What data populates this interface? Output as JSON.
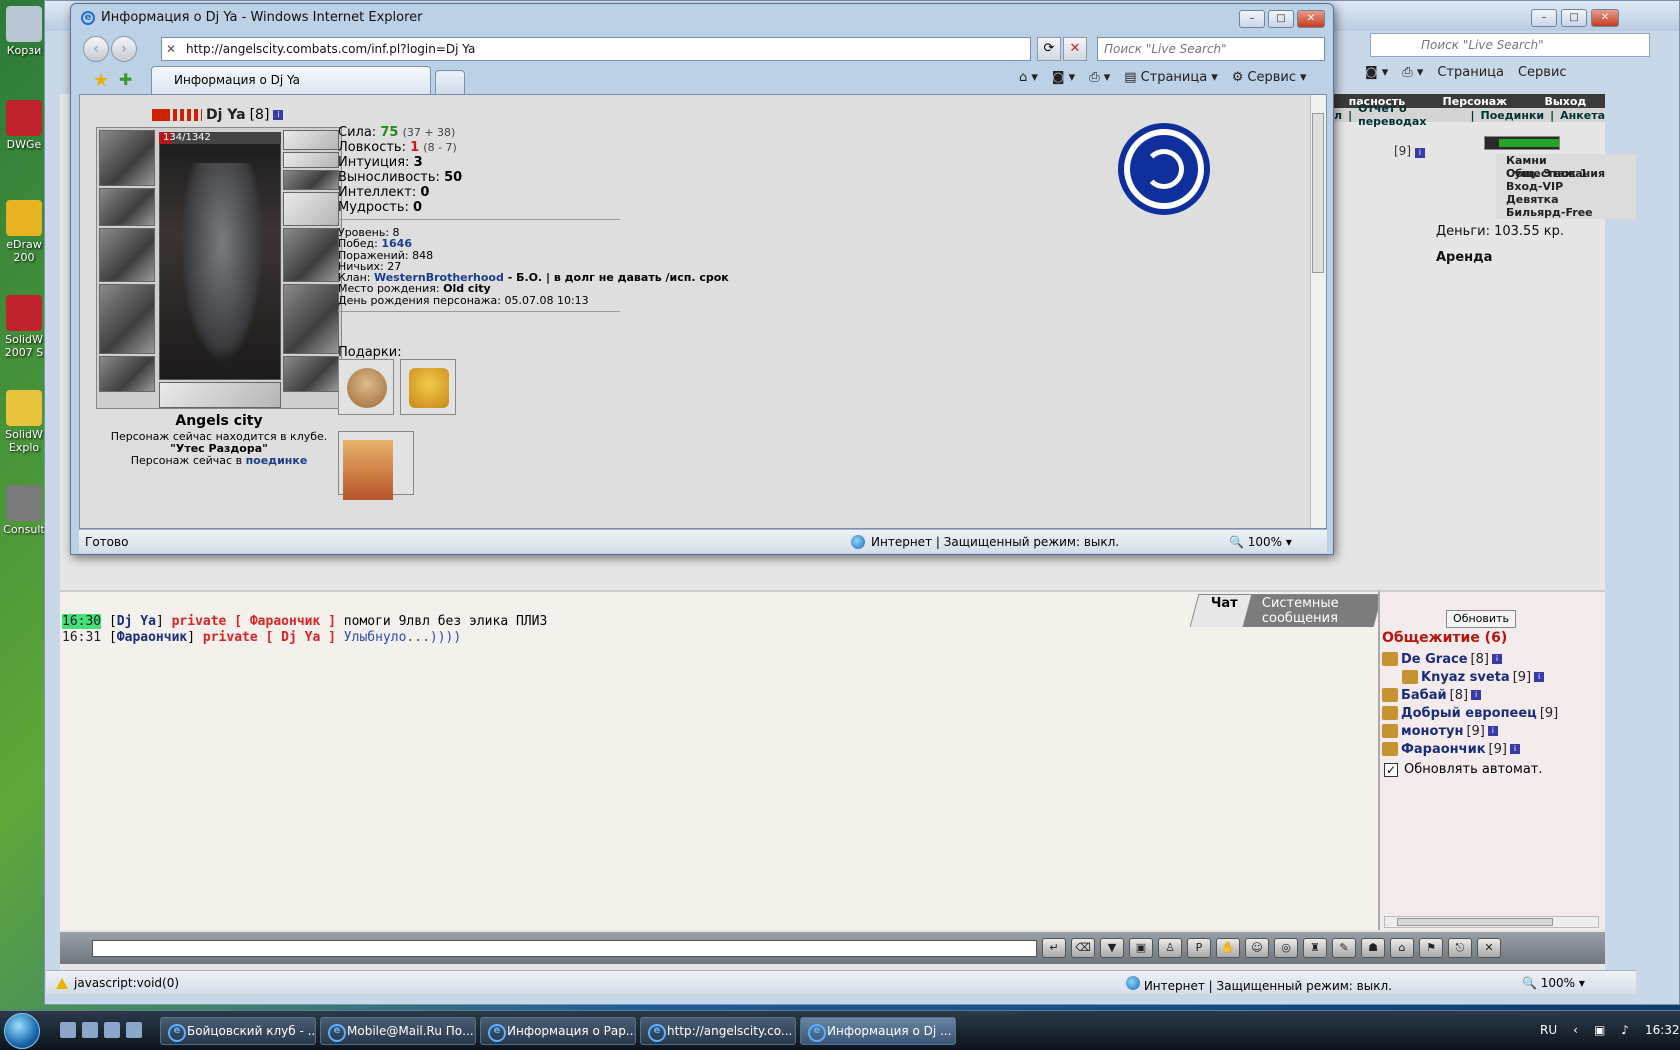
{
  "desktop_icons": [
    "Корзи",
    "DWGe",
    "eDraw 200",
    "SolidW 2007 S",
    "SolidW Explo",
    "Consult"
  ],
  "back_window": {
    "search_placeholder": "Поиск \"Live Search\"",
    "toolbar": {
      "page": "Страница",
      "service": "Сервис"
    },
    "game_nav": {
      "danger": "пасность",
      "person": "Персонаж",
      "exit": "Выход"
    },
    "game_subnav": [
      "л",
      "Отчет о переводах",
      "Поединки",
      "Анкета"
    ],
    "level_badge": "[9]",
    "right_links": [
      "Камни Существования",
      "Общ. Этаж 1",
      "Вход-VIP",
      "Девятка",
      "Бильярд-Free"
    ],
    "money": "Деньги: 103.55 кр.",
    "rent": "Аренда",
    "chat": {
      "tabs": [
        "Чат",
        "Системные сообщения"
      ],
      "lines": [
        {
          "time": "16:30",
          "from": "Dj Ya",
          "private": "private [ Фараончик ]",
          "text": "помоги 9лвл без элика ПЛИЗ"
        },
        {
          "time": "16:31",
          "from": "Фараончик",
          "private": "private [ Dj Ya ]",
          "text": "Улыбнуло...))))"
        }
      ]
    },
    "online": {
      "refresh": "Обновить",
      "title": "Общежитие (6)",
      "users": [
        {
          "name": "De Grace",
          "level": "[8]"
        },
        {
          "name": "Knyaz sveta",
          "level": "[9]"
        },
        {
          "name": "Бабай",
          "level": "[8]"
        },
        {
          "name": "Добрый европеец",
          "level": "[9]"
        },
        {
          "name": "монотун",
          "level": "[9]"
        },
        {
          "name": "Фараончик",
          "level": "[9]"
        }
      ],
      "auto_refresh": "Обновлять автомат."
    },
    "status": {
      "left": "javascript:void(0)",
      "zone": "Интернет | Защищенный режим: выкл.",
      "zoom": "100%"
    }
  },
  "front_window": {
    "title": "Информация о Dj Ya - Windows Internet Explorer",
    "url": "http://angelscity.combats.com/inf.pl?login=Dj Ya",
    "search_placeholder": "Поиск \"Live Search\"",
    "tab": "Информация о Dj Ya",
    "toolbar": {
      "page": "Страница",
      "service": "Сервис"
    },
    "status": {
      "ready": "Готово",
      "zone": "Интернет | Защищенный режим: выкл.",
      "zoom": "100%"
    }
  },
  "character": {
    "name": "Dj Ya",
    "level": "[8]",
    "hp": "134/1342",
    "hp_fraction": 0.1,
    "stats": [
      {
        "label": "Сила:",
        "value": "75",
        "extra": "(37 + 38)",
        "color": "g"
      },
      {
        "label": "Ловкость:",
        "value": "1",
        "extra": "(8 - 7)",
        "color": "r"
      },
      {
        "label": "Интуиция:",
        "value": "3",
        "extra": "",
        "color": ""
      },
      {
        "label": "Выносливость:",
        "value": "50",
        "extra": "",
        "color": ""
      },
      {
        "label": "Интеллект:",
        "value": "0",
        "extra": "",
        "color": ""
      },
      {
        "label": "Мудрость:",
        "value": "0",
        "extra": "",
        "color": ""
      }
    ],
    "info": {
      "level_label": "Уровень:",
      "level_value": "8",
      "wins_label": "Побед:",
      "wins_value": "1646",
      "losses_label": "Поражений:",
      "losses_value": "848",
      "draws_label": "Ничьих:",
      "draws_value": "27",
      "clan_label": "Клан:",
      "clan_name": "WesternBrotherhood",
      "clan_desc": " - Б.О. | в долг не давать /исп. срок",
      "birthplace_label": "Место рождения:",
      "birthplace_value": "Old city",
      "birthday_label": "День рождения персонажа:",
      "birthday_value": "05.07.08 10:13"
    },
    "city": "Angels city",
    "location_line1": "Персонаж сейчас находится в клубе.",
    "location_club": "\"Утес Раздора\"",
    "location_line2": "Персонаж сейчас в",
    "location_link": "поединке",
    "gifts_label": "Подарки:"
  },
  "taskbar": {
    "tasks": [
      "Бойцовский клуб - ...",
      "Mobile@Mail.Ru По...",
      "Информация о Рар...",
      "http://angelscity.co...",
      "Информация о Dj ..."
    ],
    "lang": "RU",
    "time": "16:32"
  }
}
